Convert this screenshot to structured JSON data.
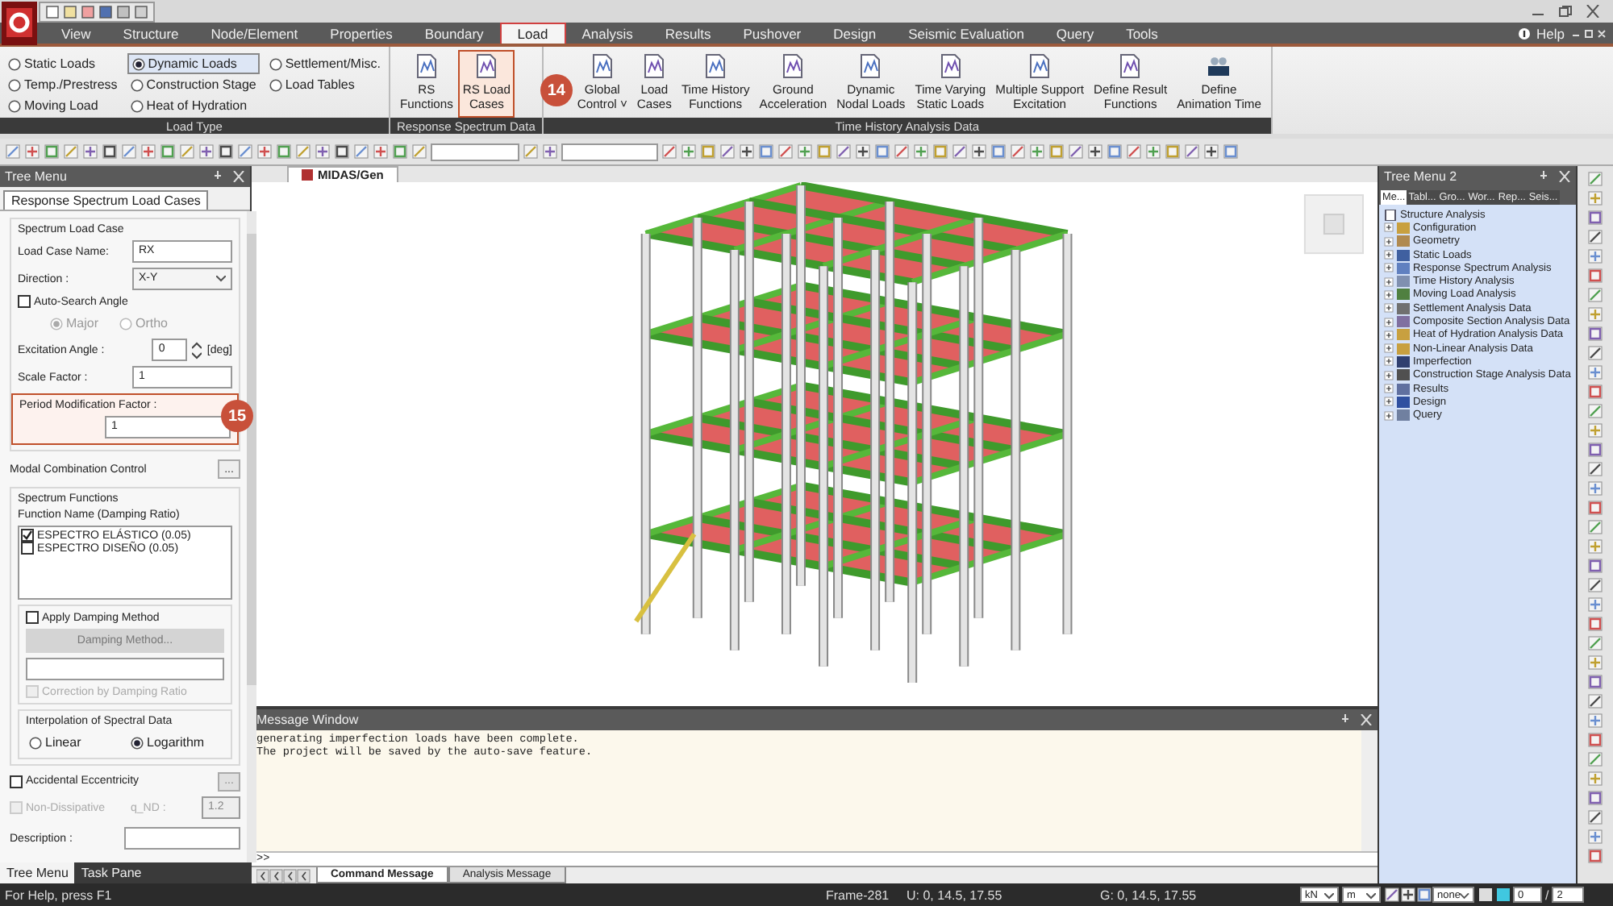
{
  "window": {
    "help": "Help"
  },
  "menu": [
    {
      "label": "View",
      "selected": false
    },
    {
      "label": "Structure",
      "selected": false
    },
    {
      "label": "Node/Element",
      "selected": false
    },
    {
      "label": "Properties",
      "selected": false
    },
    {
      "label": "Boundary",
      "selected": false
    },
    {
      "label": "Load",
      "selected": true
    },
    {
      "label": "Analysis",
      "selected": false
    },
    {
      "label": "Results",
      "selected": false
    },
    {
      "label": "Pushover",
      "selected": false
    },
    {
      "label": "Design",
      "selected": false
    },
    {
      "label": "Seismic Evaluation",
      "selected": false
    },
    {
      "label": "Query",
      "selected": false
    },
    {
      "label": "Tools",
      "selected": false
    }
  ],
  "ribbon": {
    "load_type": {
      "title": "Load Type",
      "options": [
        {
          "label": "Static Loads",
          "selected": false
        },
        {
          "label": "Temp./Prestress",
          "selected": false
        },
        {
          "label": "Moving Load",
          "selected": false
        },
        {
          "label": "Dynamic Loads",
          "selected": true
        },
        {
          "label": "Construction Stage",
          "selected": false
        },
        {
          "label": "Heat of Hydration",
          "selected": false
        },
        {
          "label": "Settlement/Misc.",
          "selected": false
        },
        {
          "label": "Load Tables",
          "selected": false
        }
      ]
    },
    "groups": [
      {
        "title": "Response Spectrum Data",
        "buttons": [
          {
            "lines": [
              "RS",
              "Functions"
            ],
            "highlighted": false
          },
          {
            "lines": [
              "RS Load",
              "Cases"
            ],
            "highlighted": true
          }
        ]
      },
      {
        "title": "Time History Analysis Data",
        "buttons": [
          {
            "lines": [
              "Global",
              "Control ˅"
            ],
            "highlighted": false
          },
          {
            "lines": [
              "Load",
              "Cases"
            ],
            "highlighted": false
          },
          {
            "lines": [
              "Time History",
              "Functions"
            ],
            "highlighted": false
          },
          {
            "lines": [
              "Ground",
              "Acceleration"
            ],
            "highlighted": false
          },
          {
            "lines": [
              "Dynamic",
              "Nodal Loads"
            ],
            "highlighted": false
          },
          {
            "lines": [
              "Time Varying",
              "Static Loads"
            ],
            "highlighted": false
          },
          {
            "lines": [
              "Multiple Support",
              "Excitation"
            ],
            "highlighted": false
          },
          {
            "lines": [
              "Define Result",
              "Functions"
            ],
            "highlighted": false
          },
          {
            "lines": [
              "Define",
              "Animation Time"
            ],
            "highlighted": false
          }
        ]
      }
    ]
  },
  "callouts": [
    "14",
    "15"
  ],
  "tree_menu": {
    "title": "Tree Menu",
    "tab": "Response Spectrum Load Cases",
    "spectrum_load_case": {
      "title": "Spectrum Load Case",
      "load_case_name": {
        "label": "Load Case Name:",
        "value": "RX"
      },
      "direction": {
        "label": "Direction :",
        "value": "X-Y"
      },
      "auto_search": {
        "label": "Auto-Search Angle",
        "checked": false
      },
      "angle_options": [
        {
          "label": "Major",
          "selected": true,
          "disabled": true
        },
        {
          "label": "Ortho",
          "selected": false,
          "disabled": true
        }
      ],
      "excitation_angle": {
        "label": "Excitation Angle :",
        "value": "0",
        "unit": "[deg]"
      },
      "scale_factor": {
        "label": "Scale Factor :",
        "value": "1"
      },
      "period_factor": {
        "label": "Period Modification Factor :",
        "value": "1",
        "highlighted": true
      }
    },
    "modal_combination": {
      "label": "Modal Combination Control",
      "button": "..."
    },
    "spectrum_functions": {
      "title": "Spectrum Functions",
      "column": "Function Name (Damping Ratio)",
      "items": [
        {
          "label": "ESPECTRO ELÁSTICO (0.05)",
          "checked": true
        },
        {
          "label": "ESPECTRO DISEÑO (0.05)",
          "checked": false
        }
      ]
    },
    "damping": {
      "label": "Apply Damping Method",
      "checked": false,
      "button": "Damping Method...",
      "button_disabled": true,
      "correction": {
        "label": "Correction by Damping Ratio",
        "checked": false,
        "disabled": true
      }
    },
    "interpolation": {
      "title": "Interpolation of Spectral Data",
      "options": [
        {
          "label": "Linear",
          "selected": false
        },
        {
          "label": "Logarithm",
          "selected": true
        }
      ]
    },
    "accidental": {
      "label": "Accidental Eccentricity",
      "checked": false,
      "button": "...",
      "button_disabled": true
    },
    "non_dissipative": {
      "label": "Non-Dissipative",
      "checked": false,
      "disabled": true,
      "q_label": "q_ND :",
      "q_value": "1.2"
    },
    "description": {
      "label": "Description :"
    },
    "bottom_tabs": [
      {
        "label": "Tree Menu",
        "selected": true
      },
      {
        "label": "Task Pane",
        "selected": false
      }
    ]
  },
  "viewport": {
    "tab": "MIDAS/Gen"
  },
  "tree_menu_2": {
    "title": "Tree Menu 2",
    "tabs": [
      {
        "label": "Me...",
        "selected": true
      },
      {
        "label": "Tabl...",
        "selected": false
      },
      {
        "label": "Gro...",
        "selected": false
      },
      {
        "label": "Wor...",
        "selected": false
      },
      {
        "label": "Rep...",
        "selected": false
      },
      {
        "label": "Seis...",
        "selected": false
      }
    ],
    "root": "Structure Analysis",
    "items": [
      {
        "label": "Configuration",
        "color": "#c8a040"
      },
      {
        "label": "Geometry",
        "color": "#b08a50"
      },
      {
        "label": "Static Loads",
        "color": "#4060a0"
      },
      {
        "label": "Response Spectrum Analysis",
        "color": "#6080c0"
      },
      {
        "label": "Time History Analysis",
        "color": "#8090b0"
      },
      {
        "label": "Moving Load Analysis",
        "color": "#508040"
      },
      {
        "label": "Settlement Analysis Data",
        "color": "#707070"
      },
      {
        "label": "Composite Section Analysis Data",
        "color": "#8070a0"
      },
      {
        "label": "Heat of Hydration Analysis Data",
        "color": "#c8a040"
      },
      {
        "label": "Non-Linear Analysis Data",
        "color": "#c8a040"
      },
      {
        "label": "Imperfection",
        "color": "#304070"
      },
      {
        "label": "Construction Stage Analysis Data",
        "color": "#505050"
      },
      {
        "label": "Results",
        "color": "#6070a0"
      },
      {
        "label": "Design",
        "color": "#3050a0"
      },
      {
        "label": "Query",
        "color": "#7080a0"
      }
    ]
  },
  "message_window": {
    "title": "Message Window",
    "lines": [
      "generating imperfection loads have been complete.",
      "The project will be saved by the auto-save feature."
    ],
    "prompt": ">>",
    "tabs": [
      {
        "label": "Command Message",
        "selected": true
      },
      {
        "label": "Analysis Message",
        "selected": false
      }
    ]
  },
  "status_bar": {
    "help": "For Help, press F1",
    "frame": "Frame-281",
    "u": "U: 0, 14.5, 17.55",
    "g": "G: 0, 14.5, 17.55",
    "force_unit": "kN",
    "length_unit": "m",
    "filter": "none",
    "page": "0",
    "separator": "/",
    "total": "2"
  }
}
